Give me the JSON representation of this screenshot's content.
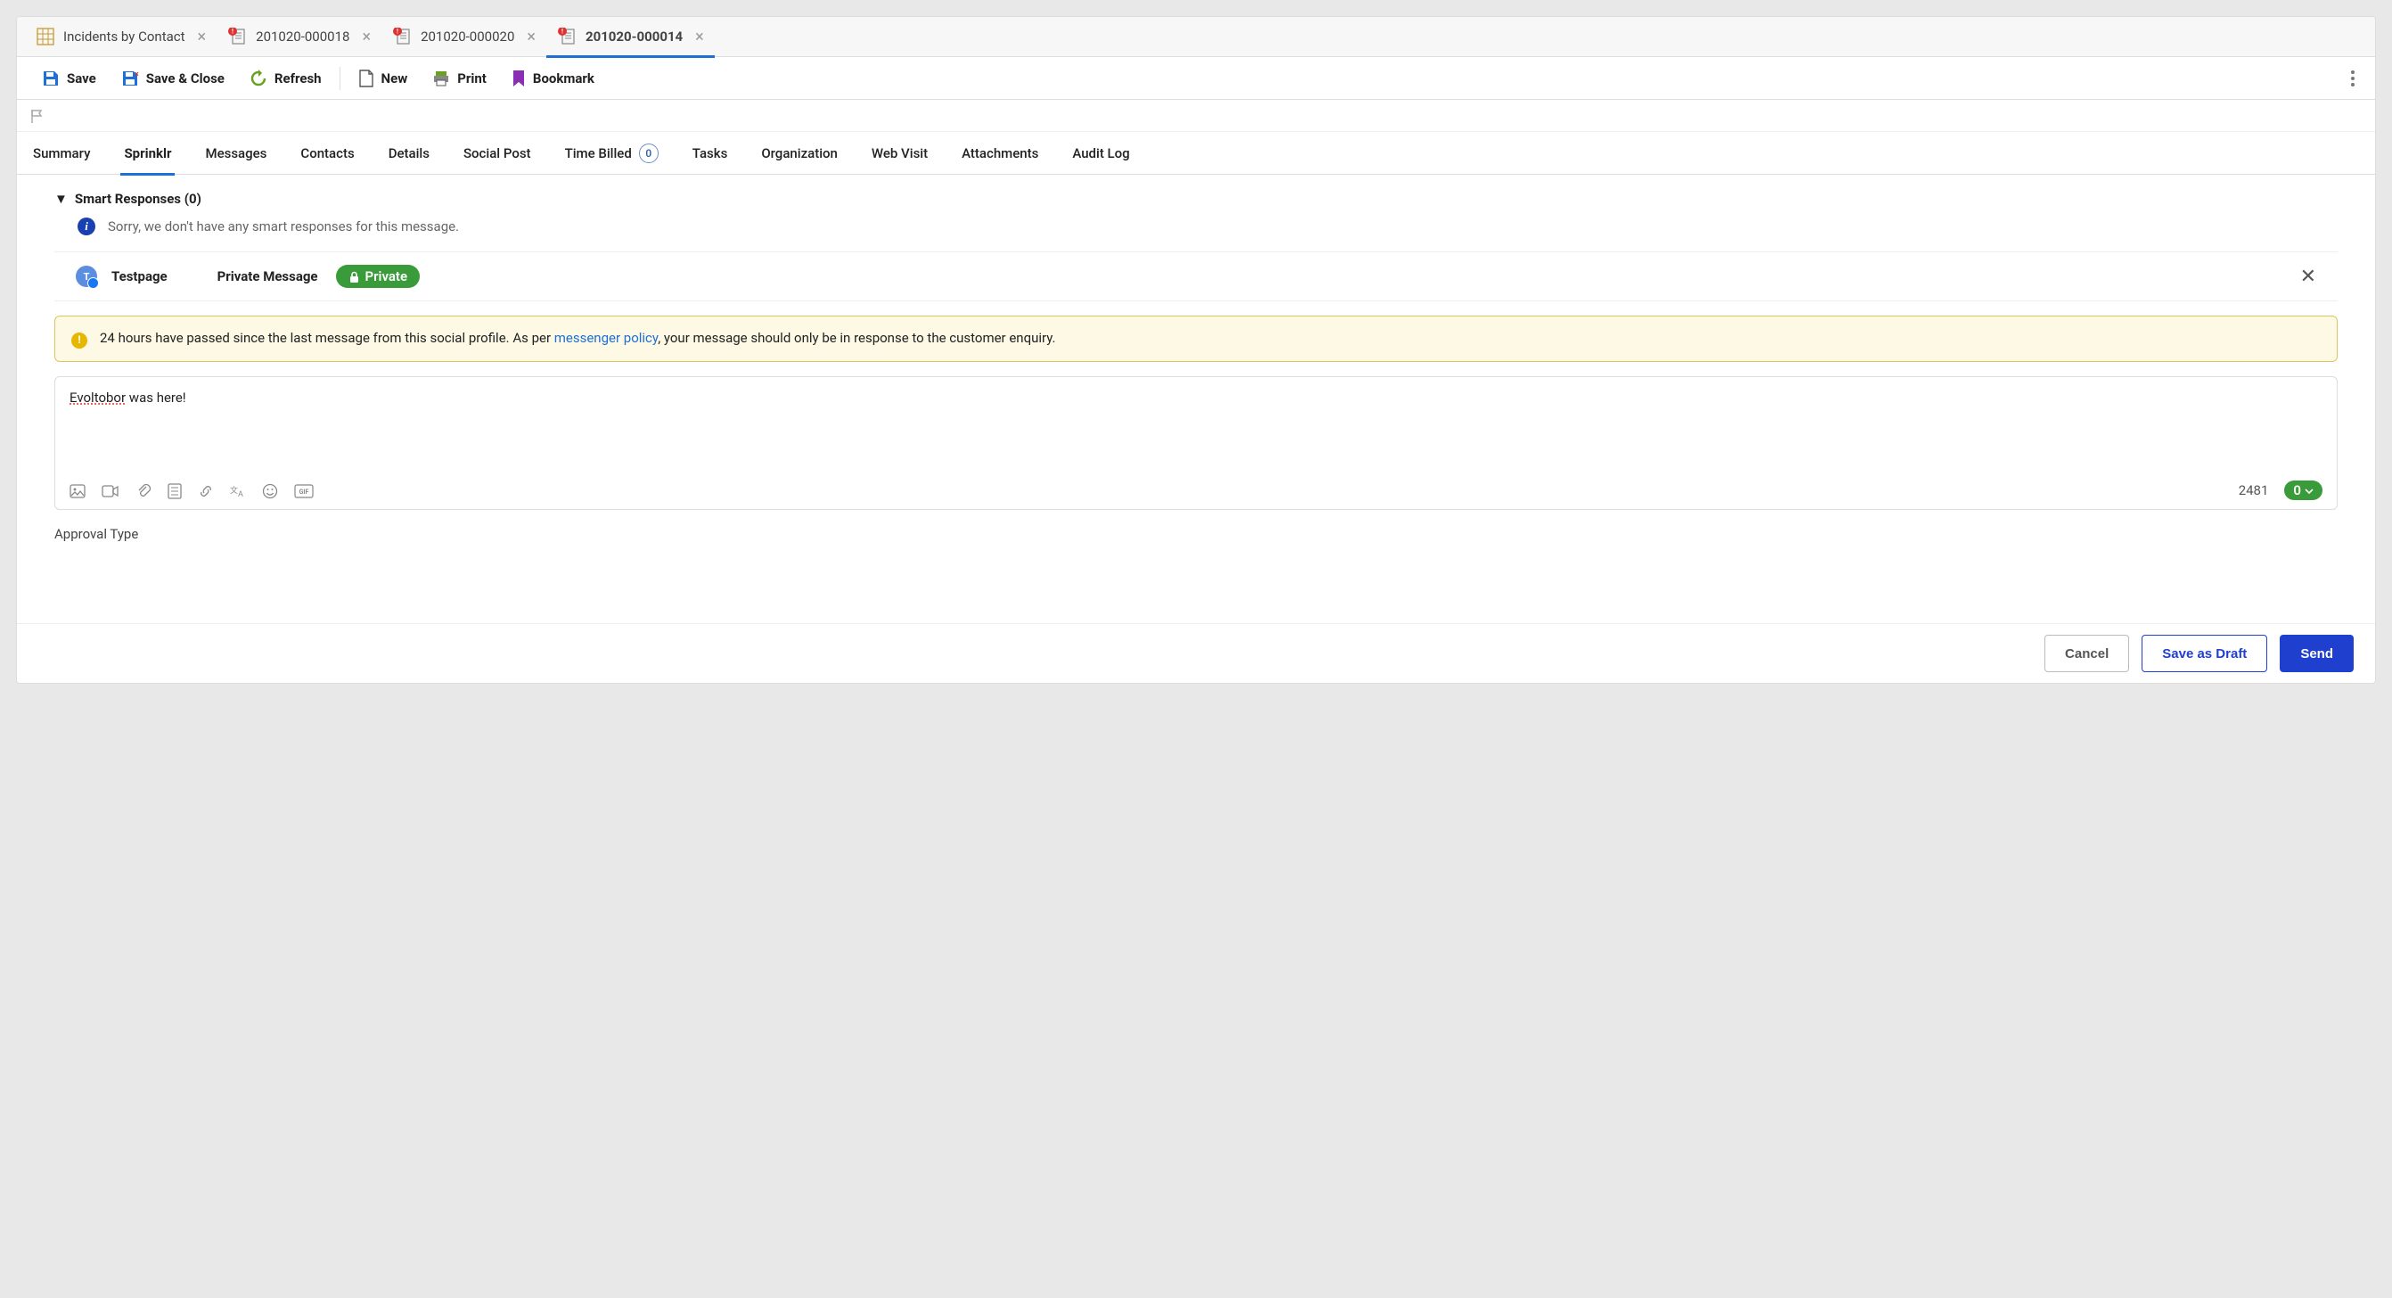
{
  "tabs": [
    {
      "label": "Incidents by Contact",
      "icon": "grid",
      "closable": true,
      "alert": false,
      "active": false
    },
    {
      "label": "201020-000018",
      "icon": "doc",
      "closable": true,
      "alert": true,
      "active": false
    },
    {
      "label": "201020-000020",
      "icon": "doc",
      "closable": true,
      "alert": true,
      "active": false
    },
    {
      "label": "201020-000014",
      "icon": "doc",
      "closable": true,
      "alert": true,
      "active": true
    }
  ],
  "toolbar": {
    "save": "Save",
    "save_close": "Save & Close",
    "refresh": "Refresh",
    "new": "New",
    "print": "Print",
    "bookmark": "Bookmark"
  },
  "subtabs": [
    {
      "label": "Summary",
      "active": false
    },
    {
      "label": "Sprinklr",
      "active": true
    },
    {
      "label": "Messages",
      "active": false
    },
    {
      "label": "Contacts",
      "active": false
    },
    {
      "label": "Details",
      "active": false
    },
    {
      "label": "Social Post",
      "active": false
    },
    {
      "label": "Time Billed",
      "active": false,
      "count": "0"
    },
    {
      "label": "Tasks",
      "active": false
    },
    {
      "label": "Organization",
      "active": false
    },
    {
      "label": "Web Visit",
      "active": false
    },
    {
      "label": "Attachments",
      "active": false
    },
    {
      "label": "Audit Log",
      "active": false
    }
  ],
  "smart_responses": {
    "header": "Smart Responses (0)",
    "empty_text": "Sorry, we don't have any smart responses for this message."
  },
  "page_row": {
    "page_name": "Testpage",
    "type_label": "Private Message",
    "privacy_pill": "Private"
  },
  "warning": {
    "text_before": "24 hours have passed since the last message from this social profile. As per ",
    "link_text": "messenger policy",
    "text_after": ", your message should only be in response to the customer enquiry."
  },
  "composer": {
    "value_word": "Evoltobor",
    "value_rest": " was here!",
    "char_count": "2481",
    "attach_count": "0"
  },
  "approval": {
    "label": "Approval Type"
  },
  "footer": {
    "cancel": "Cancel",
    "save_draft": "Save as Draft",
    "send": "Send"
  },
  "colors": {
    "accent_blue": "#1f6fd6",
    "primary_blue": "#1f3fcf",
    "green": "#3a9b3a",
    "warn_bg": "#fdf9e5",
    "warn_border": "#dcc55d"
  }
}
